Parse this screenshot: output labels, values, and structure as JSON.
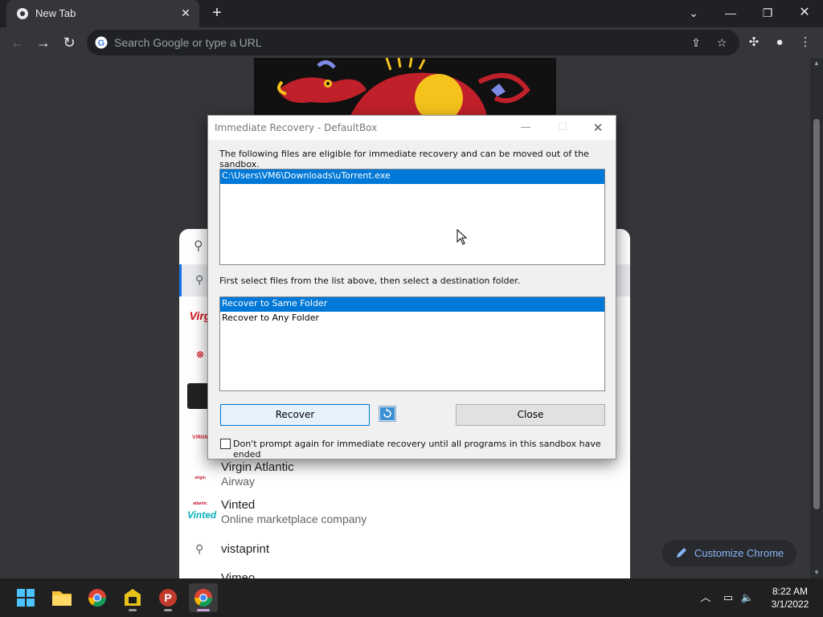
{
  "browser": {
    "tab_title": "New Tab",
    "omnibox_placeholder": "Search Google or type a URL"
  },
  "suggestions": [
    {
      "title": "Virgin Atlantic",
      "subtitle": "Airway",
      "logo_text": "virgin atlantic"
    },
    {
      "title": "Vinted",
      "subtitle": "Online marketplace company",
      "logo_text": "Vinted"
    },
    {
      "title": "vistaprint",
      "subtitle": "",
      "logo_text": ""
    },
    {
      "title": "Vimeo",
      "subtitle": "",
      "logo_text": ""
    }
  ],
  "customize_label": "Customize Chrome",
  "dialog": {
    "title": "Immediate Recovery - DefaultBox",
    "files_label": "The following files are eligible for immediate recovery and can be moved out of the sandbox.",
    "files": [
      "C:\\Users\\VM6\\Downloads\\uTorrent.exe"
    ],
    "dest_label": "First select files from the list above, then select a destination folder.",
    "destinations": [
      "Recover to Same Folder",
      "Recover to Any Folder"
    ],
    "recover_label": "Recover",
    "close_label": "Close",
    "checkbox_label": "Don't prompt again for immediate recovery until all programs in this sandbox have ended",
    "checkbox_checked": false
  },
  "taskbar": {
    "time": "8:22 AM",
    "date": "3/1/2022"
  },
  "colors": {
    "selection": "#0078d7",
    "chrome_dark": "#35363a",
    "accent_blue": "#8ab4f8"
  }
}
